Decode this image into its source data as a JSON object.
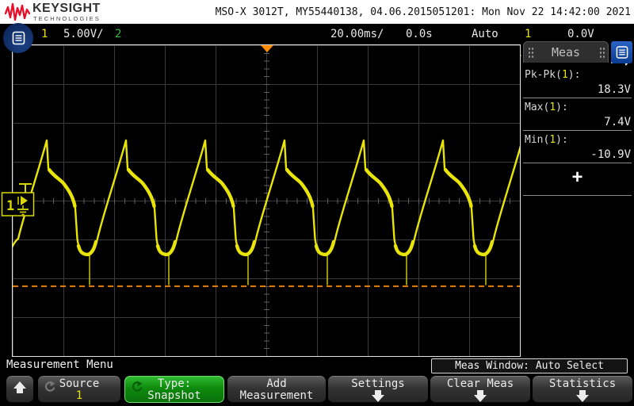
{
  "header": {
    "brand": "KEYSIGHT",
    "brand_sub": "TECHNOLOGIES",
    "title": "MSO-X 3012T, MY55440138, 04.06.2015051201: Mon Nov 22 14:42:00 2021"
  },
  "toolbar": {
    "ch1": "1",
    "ch1_scale": "5.00V/",
    "ch2": "2",
    "timebase": "20.00ms/",
    "delay": "0.0s",
    "trig_mode": "Auto",
    "trig_source": "1",
    "trig_level": "0.0V"
  },
  "display": {
    "ch1_badge": "1"
  },
  "meas_panel": {
    "title": "Meas",
    "rows": [
      {
        "pre": "Pk-Pk(",
        "ch": "1",
        "post": "):",
        "value": "18.3V"
      },
      {
        "pre": "Max(",
        "ch": "1",
        "post": "):",
        "value": "7.4V"
      },
      {
        "pre": "Min(",
        "ch": "1",
        "post": "):",
        "value": "-10.9V"
      }
    ],
    "add_label": "+"
  },
  "menu": {
    "title": "Measurement Menu",
    "meas_window": "Meas Window: Auto Select",
    "buttons": [
      {
        "line1": "Source",
        "line2": "1"
      },
      {
        "line1": "Type:",
        "line2": "Snapshot"
      },
      {
        "line1": "Add",
        "line2": "Measurement"
      },
      {
        "line1": "Settings"
      },
      {
        "line1": "Clear Meas"
      },
      {
        "line1": "Statistics"
      }
    ]
  },
  "colors": {
    "ch1_yellow": "#e8e408",
    "ch2_green": "#3db83d",
    "min_orange": "#ff8c00",
    "softkey_green": "#18a018",
    "accent_blue": "#1a52b0"
  }
}
